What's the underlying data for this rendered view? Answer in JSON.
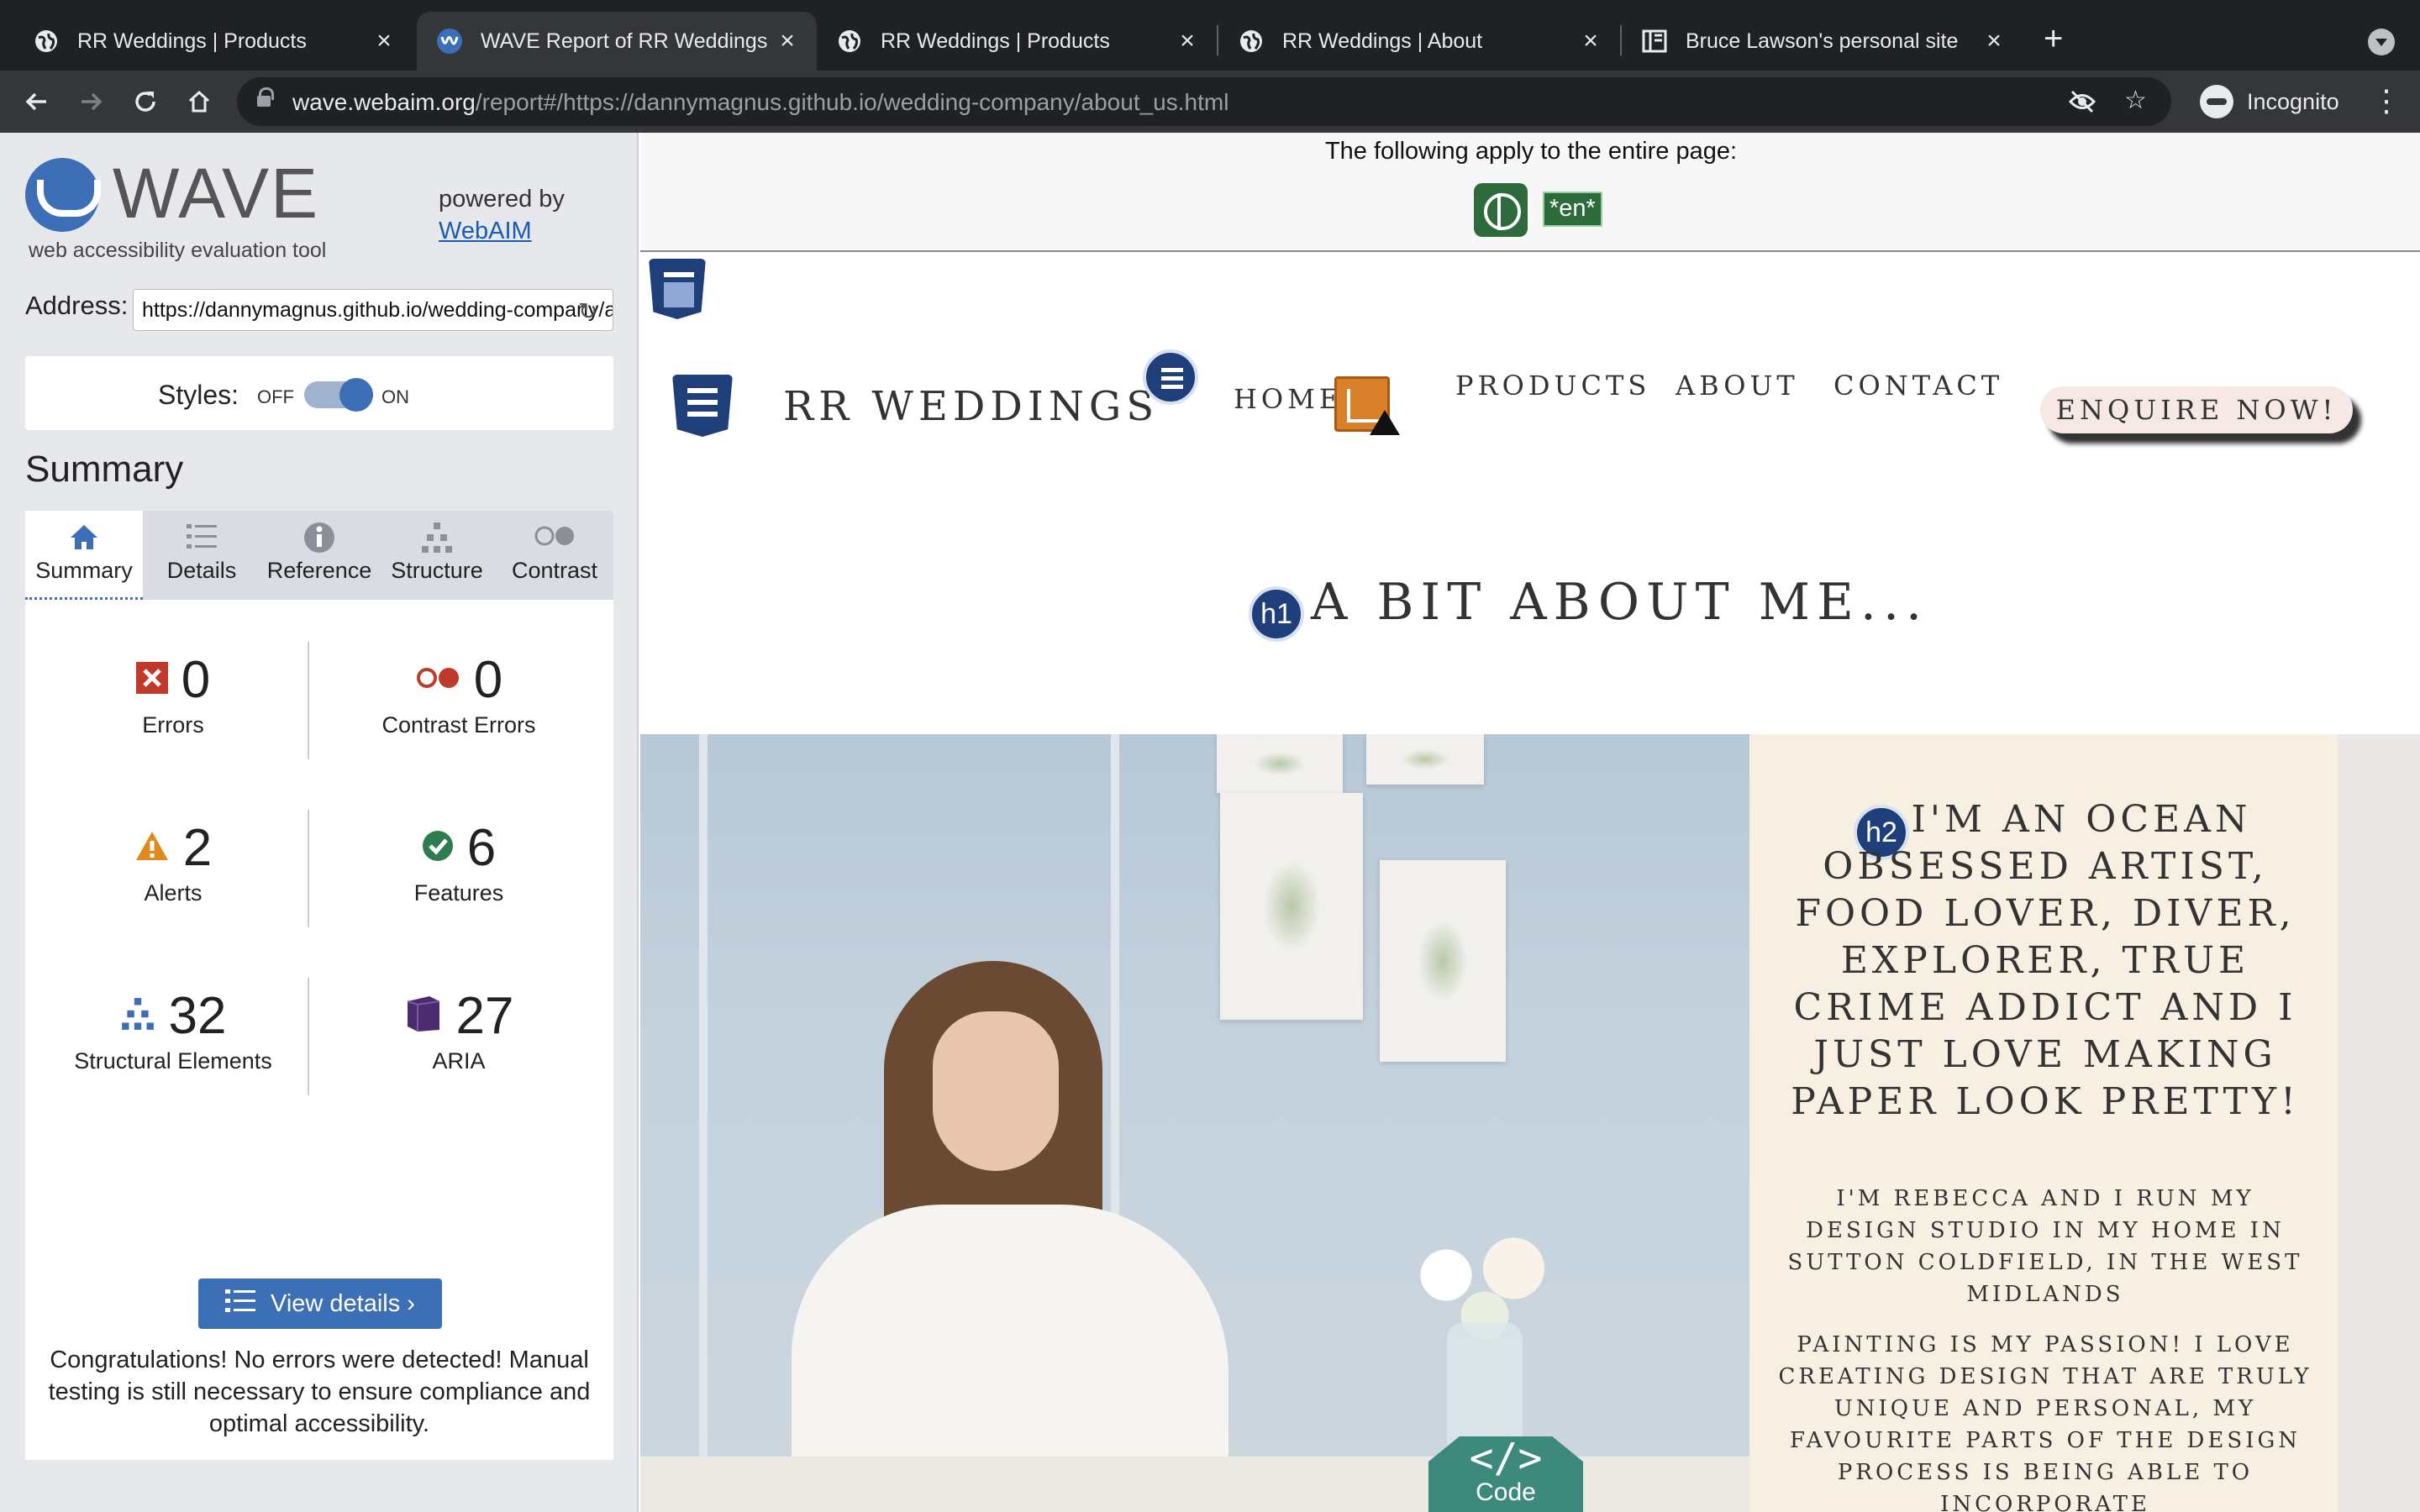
{
  "browser": {
    "tabs": [
      {
        "title": "RR Weddings | Products",
        "active": false,
        "icon": "globe-icon"
      },
      {
        "title": "WAVE Report of RR Weddings |",
        "active": true,
        "icon": "wave-icon"
      },
      {
        "title": "RR Weddings | Products",
        "active": false,
        "icon": "globe-icon"
      },
      {
        "title": "RR Weddings | About",
        "active": false,
        "icon": "globe-icon"
      },
      {
        "title": "Bruce Lawson's personal site",
        "active": false,
        "icon": "book-icon"
      }
    ],
    "url_host": "wave.webaim.org",
    "url_rest": "/report#/https://dannymagnus.github.io/wedding-company/about_us.html",
    "profile_label": "Incognito"
  },
  "wave": {
    "logo_word": "WAVE",
    "subtitle": "web accessibility evaluation tool",
    "powered_by": "powered by",
    "powered_link": "WebAIM",
    "address_label": "Address:",
    "address_value": "https://dannymagnus.github.io/wedding-company/about_us.html",
    "styles_label": "Styles:",
    "styles_off": "OFF",
    "styles_on": "ON",
    "summary_heading": "Summary",
    "tabs": [
      {
        "label": "Summary",
        "icon": "home-icon",
        "active": true
      },
      {
        "label": "Details",
        "icon": "list-icon",
        "active": false
      },
      {
        "label": "Reference",
        "icon": "info-icon",
        "active": false
      },
      {
        "label": "Structure",
        "icon": "structure-icon",
        "active": false
      },
      {
        "label": "Contrast",
        "icon": "contrast-icon",
        "active": false
      }
    ],
    "stats": [
      {
        "label": "Errors",
        "value": "0",
        "icon": "error-icon",
        "color": "#c0392b"
      },
      {
        "label": "Contrast Errors",
        "value": "0",
        "icon": "contrast-error-icon",
        "color": "#c0392b"
      },
      {
        "label": "Alerts",
        "value": "2",
        "icon": "alert-icon",
        "color": "#e08a1e"
      },
      {
        "label": "Features",
        "value": "6",
        "icon": "feature-icon",
        "color": "#2e7d4f"
      },
      {
        "label": "Structural Elements",
        "value": "32",
        "icon": "structure-icon",
        "color": "#3c6fb6"
      },
      {
        "label": "ARIA",
        "value": "27",
        "icon": "aria-icon",
        "color": "#4b2c6e"
      }
    ],
    "view_details": "View details ›",
    "congrats": "Congratulations! No errors were detected! Manual testing is still necessary to ensure compliance and optimal accessibility."
  },
  "page": {
    "applies_text": "The following apply to the entire page:",
    "lang_badge": "*en*",
    "brand": "RR WEDDINGS",
    "nav": [
      "HOME",
      "PRODUCTS",
      "ABOUT",
      "CONTACT"
    ],
    "enquire": "ENQUIRE NOW!",
    "h1_badge": "h1",
    "h1": "A BIT ABOUT ME...",
    "h2_badge": "h2",
    "h2": "I'M AN OCEAN OBSESSED ARTIST, FOOD LOVER, DIVER, EXPLORER, TRUE CRIME ADDICT AND I JUST LOVE MAKING PAPER LOOK PRETTY!",
    "para1": "I'M REBECCA AND I RUN MY DESIGN STUDIO IN MY HOME IN SUTTON COLDFIELD, IN THE WEST MIDLANDS",
    "para2": "PAINTING IS MY PASSION! I LOVE CREATING DESIGN THAT ARE TRULY UNIQUE AND PERSONAL, MY FAVOURITE PARTS OF THE DESIGN PROCESS IS BEING ABLE TO INCORPORATE",
    "code_label": "Code",
    "code_symbol": "</>"
  },
  "colors": {
    "wave_blue": "#3c6fb6",
    "chrome_dark": "#202124",
    "feature_green": "#2e6b3c",
    "cream": "#f8efe3"
  }
}
